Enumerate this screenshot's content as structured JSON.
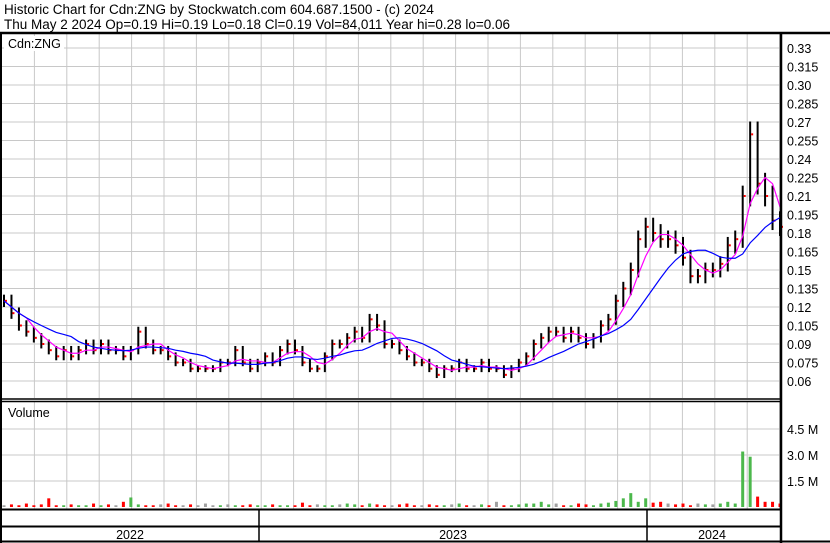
{
  "header": {
    "title": "Historic Chart for Cdn:ZNG by Stockwatch.com 604.687.1500 - (c) 2024",
    "quote": "Thu May  2 2024   Op=0.19  Hi=0.19  Lo=0.18  Cl=0.19  Vol=84,011  Year hi=0.28  lo=0.06"
  },
  "chart_data": {
    "type": "bar",
    "subtype": "ohlc-with-volume",
    "price_label": "Cdn:ZNG",
    "volume_label": "Volume",
    "ylim": [
      0.06,
      0.33
    ],
    "y_ticks": [
      "0.33",
      "0.315",
      "0.30",
      "0.285",
      "0.27",
      "0.255",
      "0.24",
      "0.225",
      "0.21",
      "0.195",
      "0.18",
      "0.165",
      "0.15",
      "0.135",
      "0.12",
      "0.105",
      "0.09",
      "0.075",
      "0.06"
    ],
    "volume_ticks": [
      "4.5 M",
      "3.0 M",
      "1.5 M"
    ],
    "volume_tick_values": [
      4.5,
      3.0,
      1.5
    ],
    "x_labels": [
      "2022",
      "2023",
      "2024"
    ],
    "colors": {
      "bar": "#000000",
      "close_tick": "#ff0000",
      "ma_short": "#ff00ff",
      "ma_long": "#0000ff",
      "vol_up": "#4cb84c",
      "vol_down": "#ff0000",
      "vol_flat": "#a0a0a0",
      "grid": "#c8c8c8"
    },
    "ma_periods": [
      4,
      10
    ],
    "close": [
      0.125,
      0.115,
      0.105,
      0.1,
      0.095,
      0.09,
      0.085,
      0.08,
      0.085,
      0.08,
      0.085,
      0.09,
      0.085,
      0.09,
      0.085,
      0.085,
      0.08,
      0.085,
      0.1,
      0.09,
      0.085,
      0.085,
      0.08,
      0.075,
      0.075,
      0.07,
      0.07,
      0.07,
      0.07,
      0.075,
      0.075,
      0.085,
      0.075,
      0.07,
      0.075,
      0.08,
      0.075,
      0.085,
      0.09,
      0.085,
      0.075,
      0.07,
      0.07,
      0.08,
      0.09,
      0.09,
      0.095,
      0.1,
      0.095,
      0.11,
      0.105,
      0.09,
      0.09,
      0.085,
      0.08,
      0.075,
      0.075,
      0.07,
      0.065,
      0.07,
      0.07,
      0.075,
      0.07,
      0.07,
      0.075,
      0.07,
      0.07,
      0.065,
      0.07,
      0.075,
      0.08,
      0.09,
      0.095,
      0.1,
      0.1,
      0.095,
      0.1,
      0.095,
      0.09,
      0.095,
      0.105,
      0.11,
      0.125,
      0.135,
      0.15,
      0.175,
      0.185,
      0.18,
      0.175,
      0.175,
      0.17,
      0.16,
      0.145,
      0.145,
      0.15,
      0.15,
      0.155,
      0.17,
      0.175,
      0.21,
      0.26,
      0.22,
      0.21,
      0.19,
      0.185
    ],
    "volume_millions": [
      0.1,
      0.15,
      0.1,
      0.2,
      0.1,
      0.15,
      0.5,
      0.1,
      0.1,
      0.15,
      0.1,
      0.1,
      0.2,
      0.1,
      0.15,
      0.1,
      0.3,
      0.55,
      0.15,
      0.1,
      0.1,
      0.15,
      0.2,
      0.1,
      0.1,
      0.15,
      0.1,
      0.2,
      0.1,
      0.1,
      0.15,
      0.1,
      0.1,
      0.15,
      0.1,
      0.1,
      0.15,
      0.1,
      0.1,
      0.1,
      0.25,
      0.1,
      0.15,
      0.1,
      0.1,
      0.15,
      0.2,
      0.15,
      0.1,
      0.2,
      0.15,
      0.1,
      0.1,
      0.15,
      0.2,
      0.1,
      0.1,
      0.15,
      0.1,
      0.1,
      0.15,
      0.2,
      0.1,
      0.1,
      0.15,
      0.1,
      0.3,
      0.1,
      0.1,
      0.15,
      0.2,
      0.2,
      0.3,
      0.15,
      0.2,
      0.1,
      0.1,
      0.2,
      0.15,
      0.1,
      0.2,
      0.25,
      0.35,
      0.5,
      0.8,
      0.3,
      0.5,
      0.25,
      0.3,
      0.2,
      0.15,
      0.2,
      0.1,
      0.2,
      0.15,
      0.15,
      0.2,
      0.3,
      0.2,
      3.2,
      2.9,
      0.6,
      0.3,
      0.3,
      0.2
    ]
  }
}
